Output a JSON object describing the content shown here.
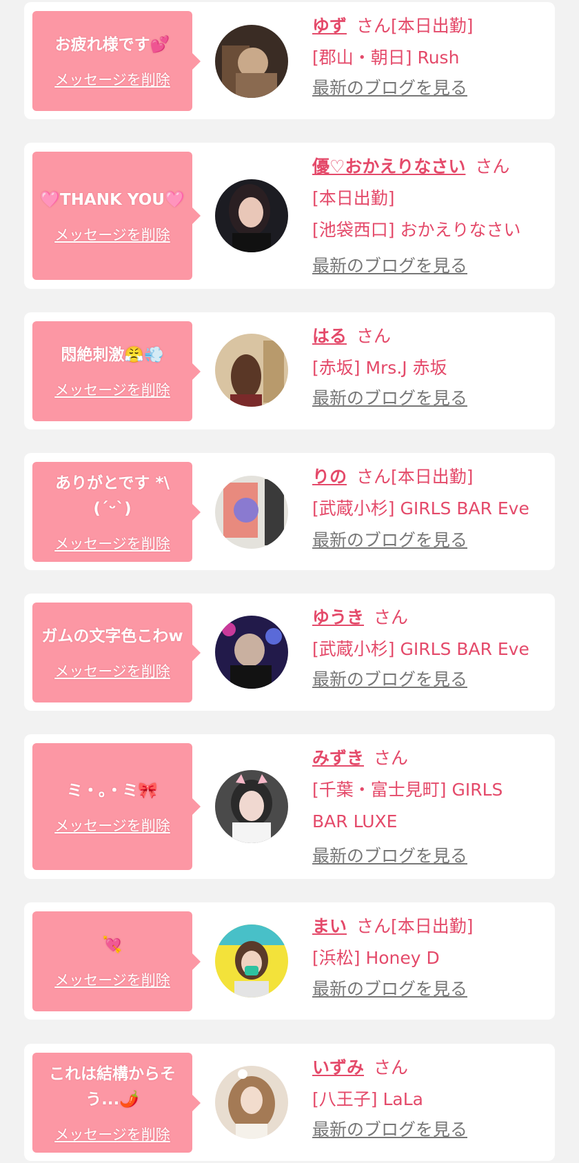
{
  "colors": {
    "bubble": "#fc97a4",
    "accent": "#e44a6a",
    "link_gray": "#777777"
  },
  "delete_label": "メッセージを削除",
  "san_label": "さん",
  "blog_label": "最新のブログを見る",
  "cards": [
    {
      "message": "お疲れ様です💕",
      "name": "ゆず",
      "status": "[本日出勤]",
      "location": "[郡山・朝日] Rush",
      "avatar": "photo-avatar"
    },
    {
      "message": "🩷THANK YOU🩷",
      "name": "優♡おかえりなさい",
      "status": "[本日出勤]",
      "location": "[池袋西口] おかえりなさい",
      "avatar": "photo-avatar"
    },
    {
      "message": "悶絶刺激😤💨",
      "name": "はる",
      "status": "",
      "location": "[赤坂] Mrs.J 赤坂",
      "avatar": "photo-avatar"
    },
    {
      "message": "ありがとです *\\(ˊᵕˋ)",
      "name": "りの",
      "status": "[本日出勤]",
      "location": "[武蔵小杉] GIRLS BAR Eve",
      "avatar": "photo-avatar"
    },
    {
      "message": "ガムの文字色こわw",
      "name": "ゆうき",
      "status": "",
      "location": "[武蔵小杉] GIRLS BAR Eve",
      "avatar": "photo-avatar"
    },
    {
      "message": "ミ・。・ミ🎀",
      "name": "みずき",
      "status": "",
      "location": "[千葉・富士見町] GIRLS BAR LUXE",
      "avatar": "photo-avatar"
    },
    {
      "message": "💘",
      "name": "まい",
      "status": "[本日出勤]",
      "location": "[浜松] Honey D",
      "avatar": "photo-avatar"
    },
    {
      "message": "これは結構からそう...🌶️",
      "name": "いずみ",
      "status": "",
      "location": "[八王子] LaLa",
      "avatar": "photo-avatar"
    }
  ]
}
